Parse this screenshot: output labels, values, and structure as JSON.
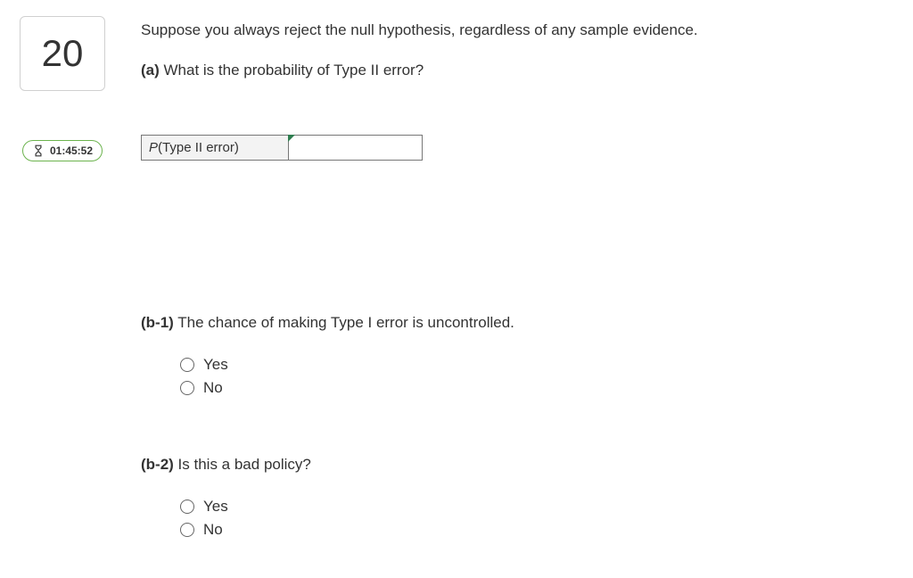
{
  "sidebar": {
    "question_number": "20",
    "timer": "01:45:52"
  },
  "content": {
    "intro": "Suppose you always reject the null hypothesis, regardless of any sample evidence.",
    "part_a": {
      "label": "(a)",
      "text": " What is the probability of Type II error?",
      "row_label_prefix_italic": "P",
      "row_label_rest": "(Type II error)"
    },
    "part_b1": {
      "label": "(b-1)",
      "text": " The chance of making Type I error is uncontrolled.",
      "options": [
        "Yes",
        "No"
      ]
    },
    "part_b2": {
      "label": "(b-2)",
      "text": " Is this a bad policy?",
      "options": [
        "Yes",
        "No"
      ]
    }
  }
}
